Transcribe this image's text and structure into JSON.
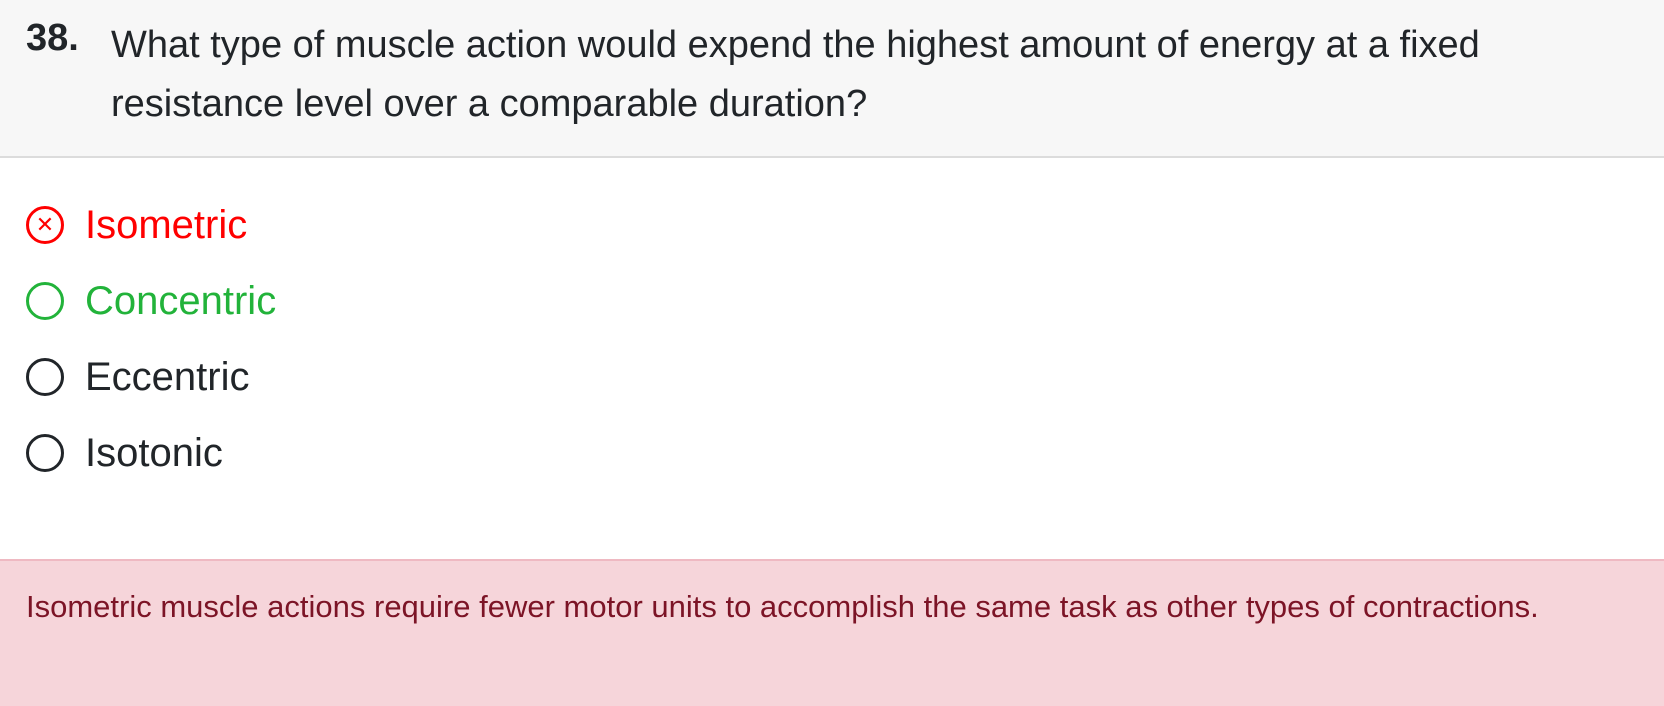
{
  "question": {
    "number": "38.",
    "text": "What type of muscle action would expend the highest amount of energy at a fixed resistance level over a comparable duration?"
  },
  "options": [
    {
      "label": "Isometric",
      "state": "selected-incorrect",
      "icon": "x-circle-icon"
    },
    {
      "label": "Concentric",
      "state": "correct",
      "icon": "radio-icon"
    },
    {
      "label": "Eccentric",
      "state": "default",
      "icon": "radio-icon"
    },
    {
      "label": "Isotonic",
      "state": "default",
      "icon": "radio-icon"
    }
  ],
  "feedback": {
    "text": "Isometric muscle actions require fewer motor units to accomplish the same task as other types of contractions."
  },
  "colors": {
    "incorrect": "#ff0000",
    "correct": "#22b33a",
    "feedback_bg": "#f6d5da",
    "feedback_text": "#7c1426",
    "header_bg": "#f7f7f7"
  }
}
